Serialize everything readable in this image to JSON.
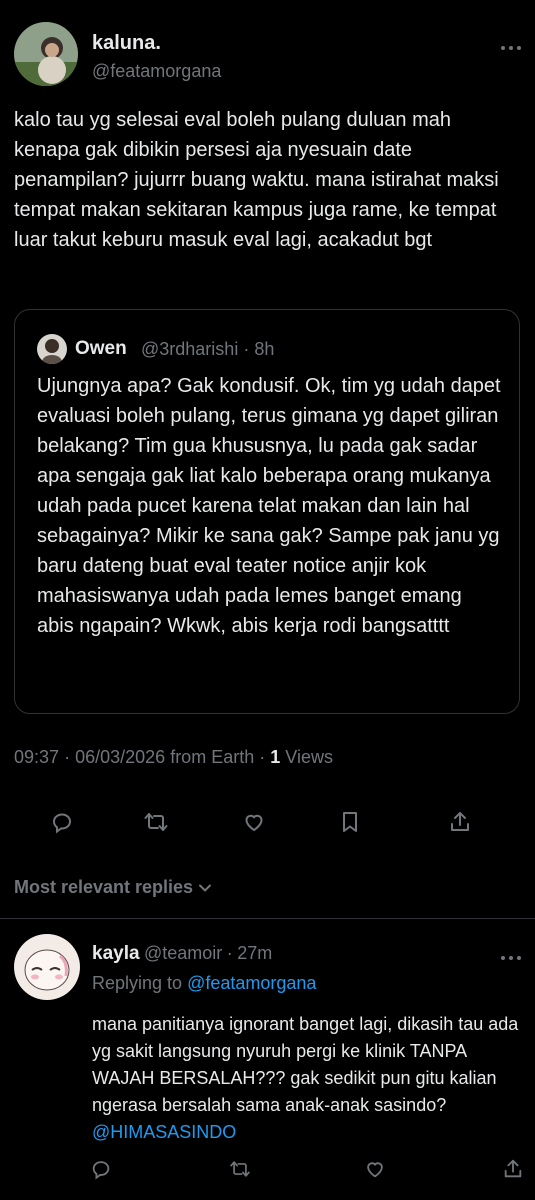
{
  "tweet": {
    "author_name": "kaluna.",
    "author_handle": "@featamorgana",
    "more_icon": "more-horizontal-icon",
    "text": "kalo tau yg selesai eval boleh pulang duluan mah kenapa gak dibikin persesi aja nyesuain date penampilan? jujurrr buang waktu. mana istirahat maksi tempat makan sekitaran kampus juga rame, ke tempat luar takut keburu masuk eval lagi, acakadut bgt",
    "quote": {
      "author_name": "Owen",
      "author_handle": "@3rdharishi",
      "separator": "·",
      "time": "8h",
      "text": "Ujungnya apa? Gak kondusif. Ok, tim yg udah dapet evaluasi boleh pulang, terus gimana yg dapet giliran belakang? Tim gua khususnya, lu pada gak sadar apa sengaja gak liat kalo beberapa orang mukanya udah pada pucet karena telat makan dan lain hal sebagainya? Mikir ke sana gak? Sampe pak janu yg baru dateng buat eval teater notice anjir kok mahasiswanya udah pada lemes banget emang abis ngapain? Wkwk, abis kerja rodi bangsatttt"
    },
    "meta": {
      "time": "09:37",
      "sep1": "·",
      "date": "06/03/2026",
      "source": "from Earth",
      "sep2": "·",
      "views_count": "1",
      "views_label": "Views"
    },
    "actions": [
      "reply-icon",
      "retweet-icon",
      "like-icon",
      "bookmark-icon",
      "share-icon"
    ]
  },
  "sort": {
    "label": "Most relevant replies",
    "icon": "chevron-down-icon"
  },
  "reply": {
    "author_name": "kayla",
    "author_handle": "@teamoir",
    "separator": "·",
    "time": "27m",
    "replying_prefix": "Replying to",
    "replying_to": "@featamorgana",
    "text": "mana panitianya ignorant banget lagi, dikasih tau ada yg sakit langsung nyuruh pergi ke klinik TANPA WAJAH BERSALAH??? gak sedikit pun gitu kalian ngerasa bersalah sama anak-anak sasindo?",
    "mention": "@HIMASASINDO",
    "actions": [
      "reply-icon",
      "retweet-icon",
      "like-icon",
      "share-icon"
    ]
  },
  "colors": {
    "background": "#000000",
    "text": "#e7e9ea",
    "muted": "#71767b",
    "accent": "#1d9bf0",
    "border": "#2f3336"
  }
}
